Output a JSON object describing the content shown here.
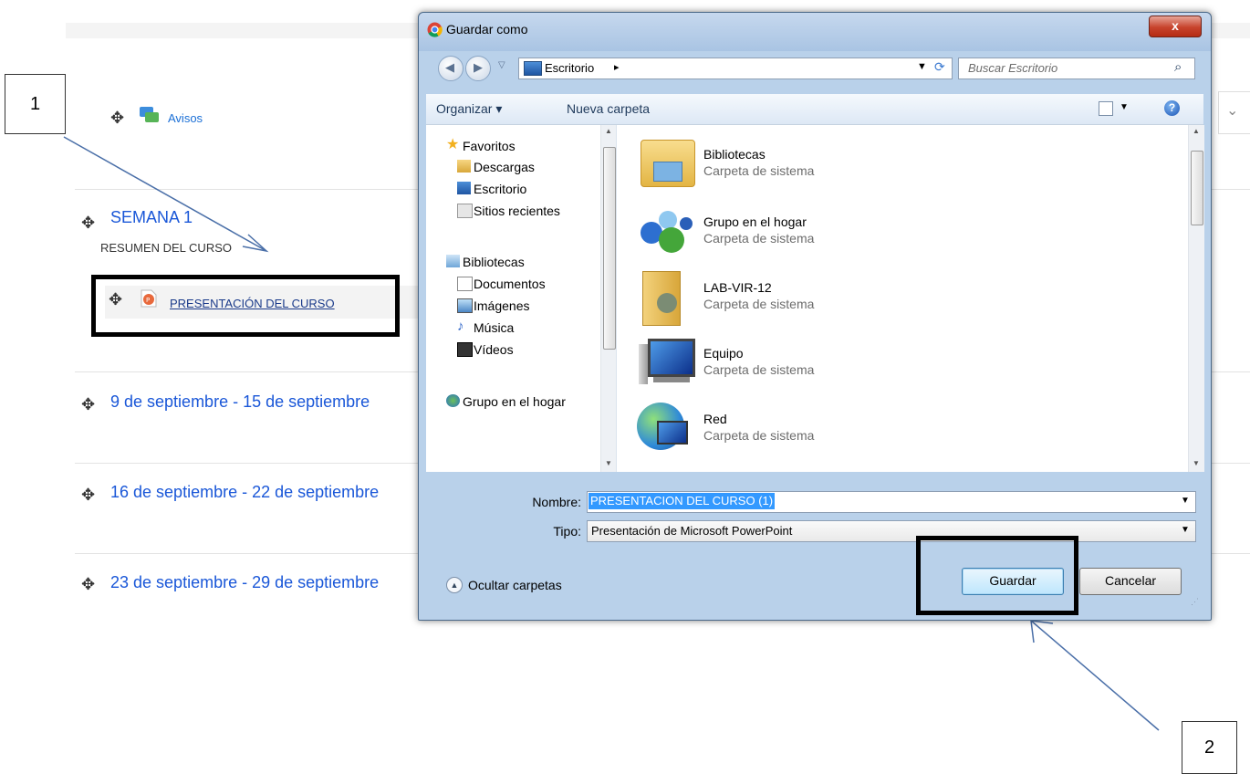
{
  "background_page": {
    "announcements_label": "Avisos",
    "section_title": "SEMANA 1",
    "section_summary": "RESUMEN DEL CURSO",
    "resource_label": "PRESENTACIÓN DEL CURSO",
    "weeks": [
      "9 de septiembre - 15 de septiembre",
      "16 de septiembre - 22 de septiembre",
      "23 de septiembre - 29 de septiembre"
    ]
  },
  "callouts": {
    "one": "1",
    "two": "2"
  },
  "dialog": {
    "title": "Guardar como",
    "close_glyph": "x",
    "address": {
      "location": "Escritorio",
      "separator": "▸"
    },
    "search_placeholder": "Buscar Escritorio",
    "toolbar": {
      "organize": "Organizar ▾",
      "new_folder": "Nueva carpeta",
      "help": "?"
    },
    "nav_tree": {
      "favorites": "Favoritos",
      "favorites_items": [
        "Descargas",
        "Escritorio",
        "Sitios recientes"
      ],
      "libraries": "Bibliotecas",
      "libraries_items": [
        "Documentos",
        "Imágenes",
        "Música",
        "Vídeos"
      ],
      "homegroup": "Grupo en el hogar"
    },
    "files": [
      {
        "name": "Bibliotecas",
        "type": "Carpeta de sistema",
        "icon": "libraries-folder-icon"
      },
      {
        "name": "Grupo en el hogar",
        "type": "Carpeta de sistema",
        "icon": "homegroup-icon"
      },
      {
        "name": "LAB-VIR-12",
        "type": "Carpeta de sistema",
        "icon": "user-folder-icon"
      },
      {
        "name": "Equipo",
        "type": "Carpeta de sistema",
        "icon": "computer-icon"
      },
      {
        "name": "Red",
        "type": "Carpeta de sistema",
        "icon": "network-icon"
      }
    ],
    "filename_label": "Nombre:",
    "filename_value": "PRESENTACION DEL CURSO (1)",
    "filetype_label": "Tipo:",
    "filetype_value": "Presentación de Microsoft PowerPoint",
    "hide_folders": "Ocultar carpetas",
    "save_button": "Guardar",
    "cancel_button": "Cancelar"
  }
}
